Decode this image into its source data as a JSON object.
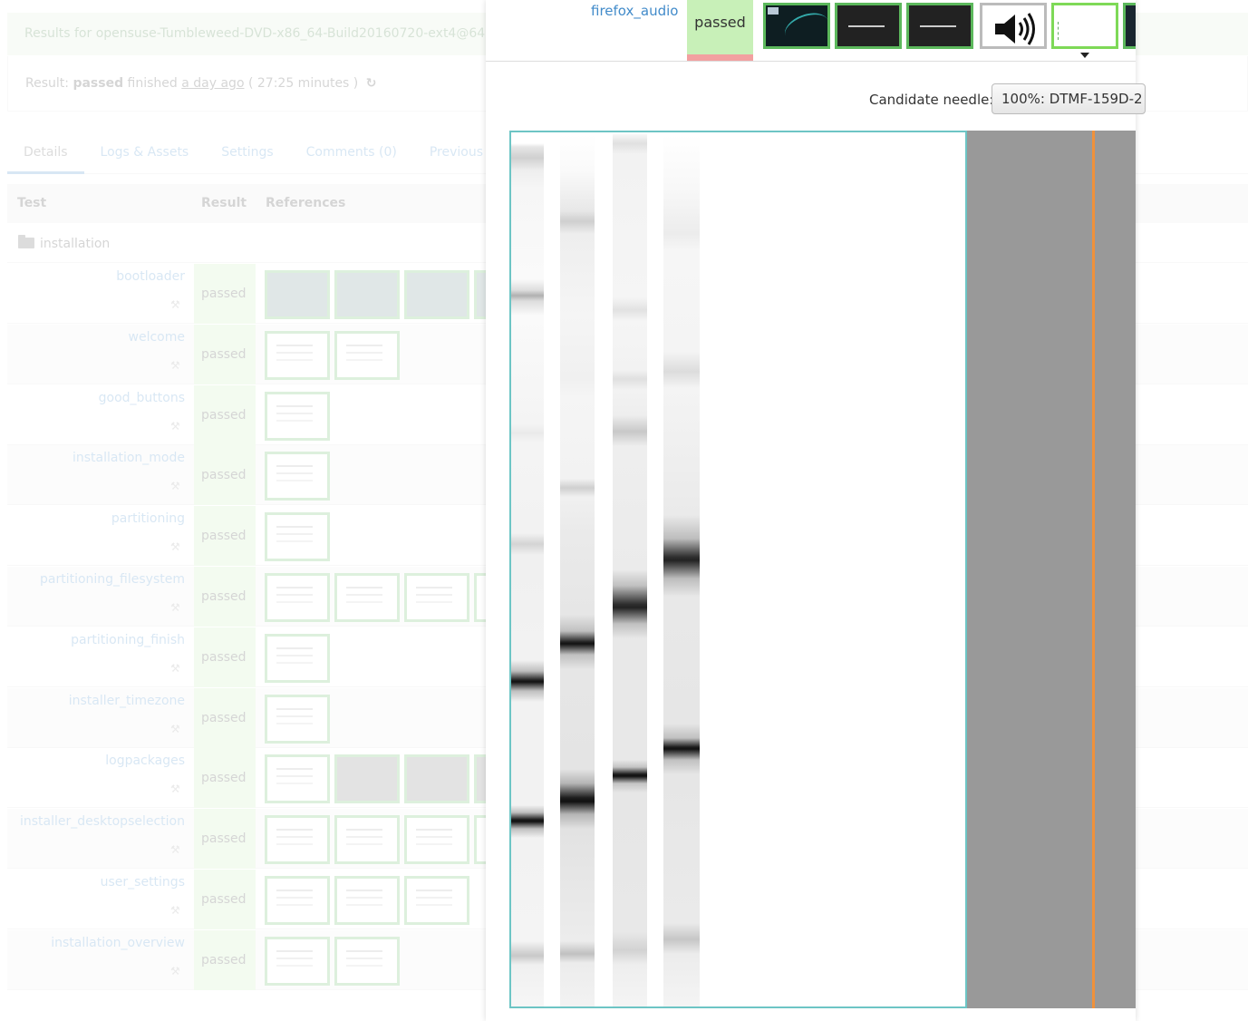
{
  "background": {
    "banner": "Results for opensuse-Tumbleweed-DVD-x86_64-Build20160720-ext4@64",
    "result": {
      "prefix": "Result:",
      "state": "passed",
      "finished": "finished",
      "ago": "a day ago",
      "duration": "( 27:25 minutes )"
    },
    "tabs": [
      "Details",
      "Logs & Assets",
      "Settings",
      "Comments (0)",
      "Previous"
    ],
    "table_headers": {
      "test": "Test",
      "result": "Result",
      "references": "References"
    },
    "group": "installation",
    "rows": [
      {
        "name": "bootloader",
        "status": "passed",
        "thumbs": [
          "dark",
          "dark",
          "dark",
          "dark"
        ]
      },
      {
        "name": "welcome",
        "status": "passed",
        "thumbs": [
          "light",
          "light"
        ]
      },
      {
        "name": "good_buttons",
        "status": "passed",
        "thumbs": [
          "light"
        ]
      },
      {
        "name": "installation_mode",
        "status": "passed",
        "thumbs": [
          "light"
        ]
      },
      {
        "name": "partitioning",
        "status": "passed",
        "thumbs": [
          "light"
        ]
      },
      {
        "name": "partitioning_filesystem",
        "status": "passed",
        "thumbs": [
          "light",
          "light",
          "light",
          "light"
        ]
      },
      {
        "name": "partitioning_finish",
        "status": "passed",
        "thumbs": [
          "light"
        ]
      },
      {
        "name": "installer_timezone",
        "status": "passed",
        "thumbs": [
          "light"
        ]
      },
      {
        "name": "logpackages",
        "status": "passed",
        "thumbs": [
          "light",
          "gray",
          "gray",
          "gray"
        ]
      },
      {
        "name": "installer_desktopselection",
        "status": "passed",
        "thumbs": [
          "light",
          "light",
          "light",
          "light"
        ]
      },
      {
        "name": "user_settings",
        "status": "passed",
        "thumbs": [
          "light",
          "light",
          "light"
        ]
      },
      {
        "name": "installation_overview",
        "status": "passed",
        "thumbs": [
          "light",
          "light"
        ]
      }
    ]
  },
  "panel": {
    "test_name": "firefox_audio",
    "status": "passed",
    "candidate_label": "Candidate needle:",
    "candidate_value": "100%: DTMF-159D-2",
    "colors": {
      "passed_bg": "#c8f0b8",
      "accent": "#428bca",
      "marker": "#f0913a",
      "frame": "#6dc5c5"
    },
    "icons": [
      "speaker-icon",
      "caret-down-icon",
      "wrench-icon",
      "folder-open-icon",
      "refresh-icon"
    ]
  }
}
